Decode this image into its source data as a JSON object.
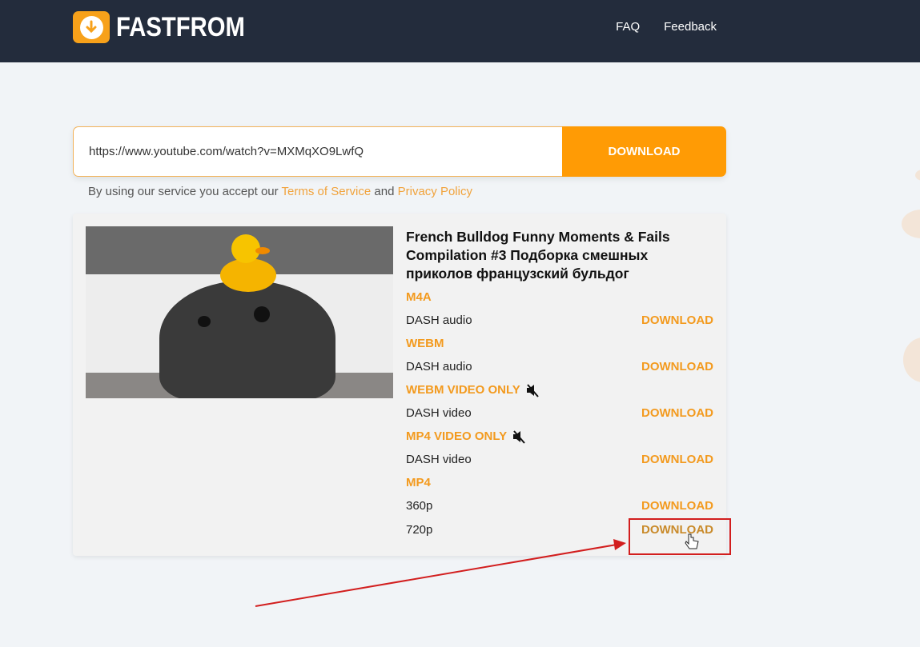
{
  "header": {
    "brand": "FASTFROM",
    "nav": [
      {
        "label": "FAQ"
      },
      {
        "label": "Feedback"
      }
    ]
  },
  "search": {
    "value": "https://www.youtube.com/watch?v=MXMqXO9LwfQ",
    "button": "DOWNLOAD"
  },
  "terms": {
    "prefix": "By using our service you accept our",
    "tos": "Terms of Service",
    "and": "and",
    "privacy": "Privacy Policy"
  },
  "video": {
    "title": "French Bulldog Funny Moments & Fails Compilation #3 Подборка смешных приколов французский бульдог",
    "formats": [
      {
        "name": "M4A",
        "muted": false,
        "items": [
          {
            "label": "DASH audio",
            "action": "DOWNLOAD"
          }
        ]
      },
      {
        "name": "WEBM",
        "muted": false,
        "items": [
          {
            "label": "DASH audio",
            "action": "DOWNLOAD"
          }
        ]
      },
      {
        "name": "WEBM VIDEO ONLY",
        "muted": true,
        "items": [
          {
            "label": "DASH video",
            "action": "DOWNLOAD"
          }
        ]
      },
      {
        "name": "MP4 VIDEO ONLY",
        "muted": true,
        "items": [
          {
            "label": "DASH video",
            "action": "DOWNLOAD"
          }
        ]
      },
      {
        "name": "MP4",
        "muted": false,
        "items": [
          {
            "label": "360p",
            "action": "DOWNLOAD"
          },
          {
            "label": "720p",
            "action": "DOWNLOAD"
          }
        ]
      }
    ]
  },
  "colors": {
    "header": "#232c3c",
    "accent": "#ff9b05",
    "link": "#f39a1e",
    "highlight": "#d21e1e"
  }
}
